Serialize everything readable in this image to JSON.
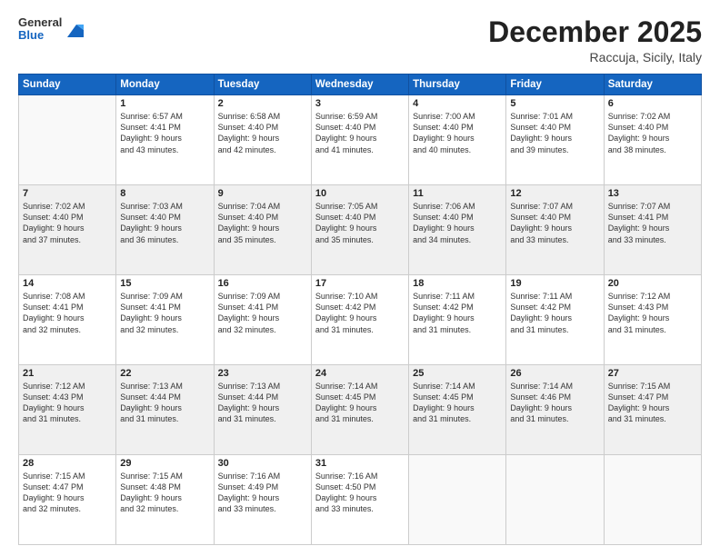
{
  "header": {
    "logo_general": "General",
    "logo_blue": "Blue",
    "month_title": "December 2025",
    "subtitle": "Raccuja, Sicily, Italy"
  },
  "days_of_week": [
    "Sunday",
    "Monday",
    "Tuesday",
    "Wednesday",
    "Thursday",
    "Friday",
    "Saturday"
  ],
  "weeks": [
    [
      {
        "day": "",
        "info": ""
      },
      {
        "day": "1",
        "info": "Sunrise: 6:57 AM\nSunset: 4:41 PM\nDaylight: 9 hours\nand 43 minutes."
      },
      {
        "day": "2",
        "info": "Sunrise: 6:58 AM\nSunset: 4:40 PM\nDaylight: 9 hours\nand 42 minutes."
      },
      {
        "day": "3",
        "info": "Sunrise: 6:59 AM\nSunset: 4:40 PM\nDaylight: 9 hours\nand 41 minutes."
      },
      {
        "day": "4",
        "info": "Sunrise: 7:00 AM\nSunset: 4:40 PM\nDaylight: 9 hours\nand 40 minutes."
      },
      {
        "day": "5",
        "info": "Sunrise: 7:01 AM\nSunset: 4:40 PM\nDaylight: 9 hours\nand 39 minutes."
      },
      {
        "day": "6",
        "info": "Sunrise: 7:02 AM\nSunset: 4:40 PM\nDaylight: 9 hours\nand 38 minutes."
      }
    ],
    [
      {
        "day": "7",
        "info": "Sunrise: 7:02 AM\nSunset: 4:40 PM\nDaylight: 9 hours\nand 37 minutes."
      },
      {
        "day": "8",
        "info": "Sunrise: 7:03 AM\nSunset: 4:40 PM\nDaylight: 9 hours\nand 36 minutes."
      },
      {
        "day": "9",
        "info": "Sunrise: 7:04 AM\nSunset: 4:40 PM\nDaylight: 9 hours\nand 35 minutes."
      },
      {
        "day": "10",
        "info": "Sunrise: 7:05 AM\nSunset: 4:40 PM\nDaylight: 9 hours\nand 35 minutes."
      },
      {
        "day": "11",
        "info": "Sunrise: 7:06 AM\nSunset: 4:40 PM\nDaylight: 9 hours\nand 34 minutes."
      },
      {
        "day": "12",
        "info": "Sunrise: 7:07 AM\nSunset: 4:40 PM\nDaylight: 9 hours\nand 33 minutes."
      },
      {
        "day": "13",
        "info": "Sunrise: 7:07 AM\nSunset: 4:41 PM\nDaylight: 9 hours\nand 33 minutes."
      }
    ],
    [
      {
        "day": "14",
        "info": "Sunrise: 7:08 AM\nSunset: 4:41 PM\nDaylight: 9 hours\nand 32 minutes."
      },
      {
        "day": "15",
        "info": "Sunrise: 7:09 AM\nSunset: 4:41 PM\nDaylight: 9 hours\nand 32 minutes."
      },
      {
        "day": "16",
        "info": "Sunrise: 7:09 AM\nSunset: 4:41 PM\nDaylight: 9 hours\nand 32 minutes."
      },
      {
        "day": "17",
        "info": "Sunrise: 7:10 AM\nSunset: 4:42 PM\nDaylight: 9 hours\nand 31 minutes."
      },
      {
        "day": "18",
        "info": "Sunrise: 7:11 AM\nSunset: 4:42 PM\nDaylight: 9 hours\nand 31 minutes."
      },
      {
        "day": "19",
        "info": "Sunrise: 7:11 AM\nSunset: 4:42 PM\nDaylight: 9 hours\nand 31 minutes."
      },
      {
        "day": "20",
        "info": "Sunrise: 7:12 AM\nSunset: 4:43 PM\nDaylight: 9 hours\nand 31 minutes."
      }
    ],
    [
      {
        "day": "21",
        "info": "Sunrise: 7:12 AM\nSunset: 4:43 PM\nDaylight: 9 hours\nand 31 minutes."
      },
      {
        "day": "22",
        "info": "Sunrise: 7:13 AM\nSunset: 4:44 PM\nDaylight: 9 hours\nand 31 minutes."
      },
      {
        "day": "23",
        "info": "Sunrise: 7:13 AM\nSunset: 4:44 PM\nDaylight: 9 hours\nand 31 minutes."
      },
      {
        "day": "24",
        "info": "Sunrise: 7:14 AM\nSunset: 4:45 PM\nDaylight: 9 hours\nand 31 minutes."
      },
      {
        "day": "25",
        "info": "Sunrise: 7:14 AM\nSunset: 4:45 PM\nDaylight: 9 hours\nand 31 minutes."
      },
      {
        "day": "26",
        "info": "Sunrise: 7:14 AM\nSunset: 4:46 PM\nDaylight: 9 hours\nand 31 minutes."
      },
      {
        "day": "27",
        "info": "Sunrise: 7:15 AM\nSunset: 4:47 PM\nDaylight: 9 hours\nand 31 minutes."
      }
    ],
    [
      {
        "day": "28",
        "info": "Sunrise: 7:15 AM\nSunset: 4:47 PM\nDaylight: 9 hours\nand 32 minutes."
      },
      {
        "day": "29",
        "info": "Sunrise: 7:15 AM\nSunset: 4:48 PM\nDaylight: 9 hours\nand 32 minutes."
      },
      {
        "day": "30",
        "info": "Sunrise: 7:16 AM\nSunset: 4:49 PM\nDaylight: 9 hours\nand 33 minutes."
      },
      {
        "day": "31",
        "info": "Sunrise: 7:16 AM\nSunset: 4:50 PM\nDaylight: 9 hours\nand 33 minutes."
      },
      {
        "day": "",
        "info": ""
      },
      {
        "day": "",
        "info": ""
      },
      {
        "day": "",
        "info": ""
      }
    ]
  ]
}
